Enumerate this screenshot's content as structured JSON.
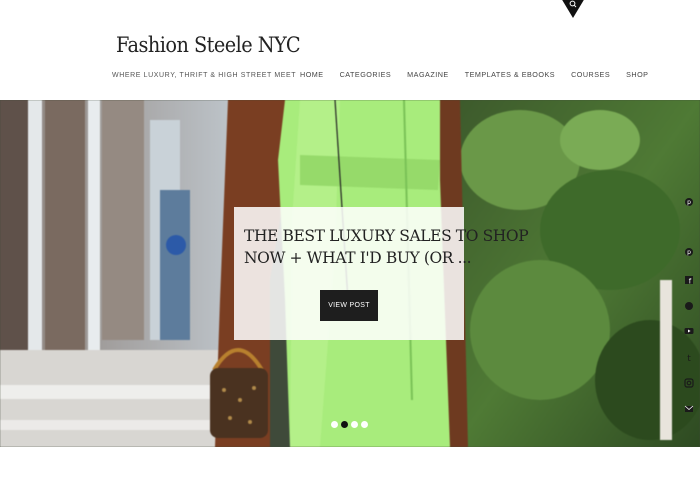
{
  "header": {
    "brand_title": "Fashion Steele NYC",
    "tagline": "WHERE LUXURY, THRIFT & HIGH STREET MEET",
    "nav": [
      "HOME",
      "CATEGORIES",
      "MAGAZINE",
      "TEMPLATES & EBOOKS",
      "COURSES",
      "SHOP"
    ]
  },
  "hero": {
    "post_title_line1": "THE BEST LUXURY SALES TO SHOP",
    "post_title_line2": "NOW + WHAT I'D BUY (OR ...",
    "button_label": "VIEW POST",
    "active_slide": 2,
    "slide_count": 4
  },
  "icons": {
    "search": "search-icon",
    "social": [
      "pinterest-icon",
      "pinterest-icon",
      "facebook-icon",
      "youtube-icon",
      "tumblr-icon",
      "instagram-icon",
      "mail-icon"
    ]
  },
  "colors": {
    "accent": "#1e1e1e",
    "dress": "#a8ec7c"
  }
}
